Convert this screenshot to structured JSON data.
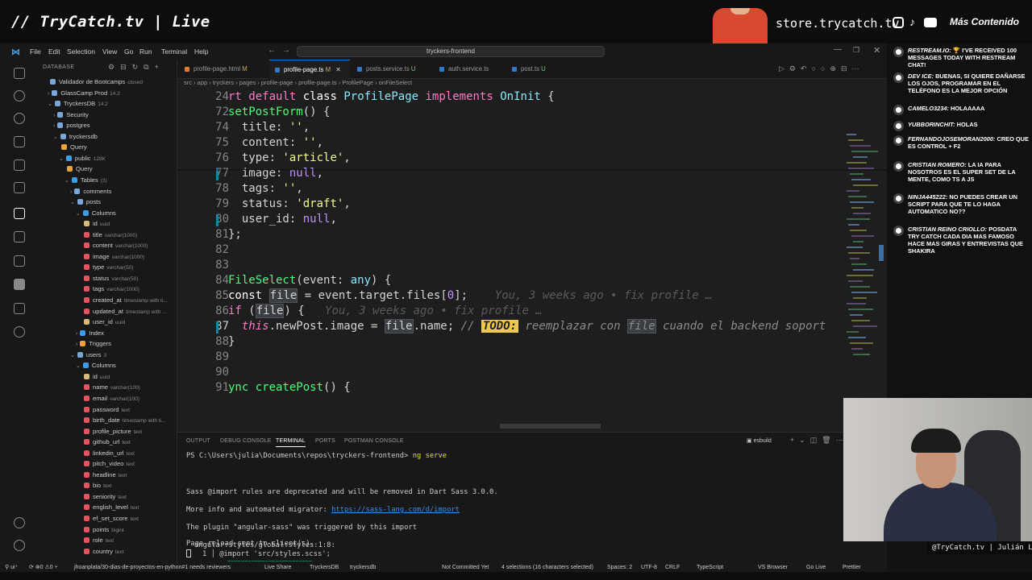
{
  "stream": {
    "title": "// TryCatch.tv | Live",
    "store": "store.trycatch.tv",
    "more_content": "Más Contenido",
    "caption": "@TryCatch.tv | Julián Luna"
  },
  "vscode": {
    "menu": [
      "File",
      "Edit",
      "Selection",
      "View",
      "Go",
      "Run",
      "Terminal",
      "Help"
    ],
    "command_center": "tryckers-frontend",
    "sidebar": {
      "title": "DATABASE",
      "tree": [
        {
          "label": "Validador de Bootcamps",
          "meta": "closed",
          "indent": 1,
          "chev": ""
        },
        {
          "label": "GlassCamp Prod",
          "meta": "14.2",
          "indent": 1,
          "chev": "›"
        },
        {
          "label": "TryckersDB",
          "meta": "14.2",
          "indent": 1,
          "chev": "⌄"
        },
        {
          "label": "Security",
          "meta": "",
          "indent": 2,
          "chev": "›"
        },
        {
          "label": "postgres",
          "meta": "",
          "indent": 2,
          "chev": "›"
        },
        {
          "label": "tryckersdb",
          "meta": "",
          "indent": 2,
          "chev": "⌄"
        },
        {
          "label": "Query",
          "meta": "",
          "indent": 3,
          "chev": ""
        },
        {
          "label": "public",
          "meta": "128K",
          "indent": 3,
          "chev": "⌄"
        },
        {
          "label": "Query",
          "meta": "",
          "indent": 4,
          "chev": ""
        },
        {
          "label": "Tables",
          "meta": "(3)",
          "indent": 4,
          "chev": "⌄"
        },
        {
          "label": "comments",
          "meta": "",
          "indent": 5,
          "chev": "›"
        },
        {
          "label": "posts",
          "meta": "",
          "indent": 5,
          "chev": "⌄"
        },
        {
          "label": "Columns",
          "meta": "",
          "indent": 6,
          "chev": "⌄"
        },
        {
          "label": "id",
          "meta": "uuid",
          "indent": 7,
          "chev": ""
        },
        {
          "label": "title",
          "meta": "varchar(1000)",
          "indent": 7,
          "chev": ""
        },
        {
          "label": "content",
          "meta": "varchar(1000)",
          "indent": 7,
          "chev": ""
        },
        {
          "label": "image",
          "meta": "varchar(1000)",
          "indent": 7,
          "chev": ""
        },
        {
          "label": "type",
          "meta": "varchar(50)",
          "indent": 7,
          "chev": ""
        },
        {
          "label": "status",
          "meta": "varchar(50)",
          "indent": 7,
          "chev": ""
        },
        {
          "label": "tags",
          "meta": "varchar(1000)",
          "indent": 7,
          "chev": ""
        },
        {
          "label": "created_at",
          "meta": "timestamp with ti...",
          "indent": 7,
          "chev": ""
        },
        {
          "label": "updated_at",
          "meta": "timestamp with ...",
          "indent": 7,
          "chev": ""
        },
        {
          "label": "user_id",
          "meta": "uuid",
          "indent": 7,
          "chev": ""
        },
        {
          "label": "Index",
          "meta": "",
          "indent": 6,
          "chev": "›"
        },
        {
          "label": "Triggers",
          "meta": "",
          "indent": 6,
          "chev": "›"
        },
        {
          "label": "users",
          "meta": "3",
          "indent": 5,
          "chev": "⌄"
        },
        {
          "label": "Columns",
          "meta": "",
          "indent": 6,
          "chev": "⌄"
        },
        {
          "label": "id",
          "meta": "uuid",
          "indent": 7,
          "chev": ""
        },
        {
          "label": "name",
          "meta": "varchar(100)",
          "indent": 7,
          "chev": ""
        },
        {
          "label": "email",
          "meta": "varchar(100)",
          "indent": 7,
          "chev": ""
        },
        {
          "label": "password",
          "meta": "text",
          "indent": 7,
          "chev": ""
        },
        {
          "label": "birth_date",
          "meta": "timestamp with ti...",
          "indent": 7,
          "chev": ""
        },
        {
          "label": "profile_picture",
          "meta": "text",
          "indent": 7,
          "chev": ""
        },
        {
          "label": "github_url",
          "meta": "text",
          "indent": 7,
          "chev": ""
        },
        {
          "label": "linkedin_url",
          "meta": "text",
          "indent": 7,
          "chev": ""
        },
        {
          "label": "pitch_video",
          "meta": "text",
          "indent": 7,
          "chev": ""
        },
        {
          "label": "headline",
          "meta": "text",
          "indent": 7,
          "chev": ""
        },
        {
          "label": "bio",
          "meta": "text",
          "indent": 7,
          "chev": ""
        },
        {
          "label": "seniority",
          "meta": "text",
          "indent": 7,
          "chev": ""
        },
        {
          "label": "english_level",
          "meta": "text",
          "indent": 7,
          "chev": ""
        },
        {
          "label": "ef_set_score",
          "meta": "text",
          "indent": 7,
          "chev": ""
        },
        {
          "label": "points",
          "meta": "bigint",
          "indent": 7,
          "chev": ""
        },
        {
          "label": "role",
          "meta": "text",
          "indent": 7,
          "chev": ""
        },
        {
          "label": "country",
          "meta": "text",
          "indent": 7,
          "chev": ""
        }
      ]
    },
    "tabs": [
      {
        "label": "profile-page.html",
        "status": "M",
        "color": "#e37933"
      },
      {
        "label": "profile-page.ts",
        "status": "M",
        "color": "#3178c6"
      },
      {
        "label": "posts.service.ts",
        "status": "U",
        "color": "#3178c6"
      },
      {
        "label": "auth.service.ts",
        "status": "",
        "color": "#3178c6"
      },
      {
        "label": "post.ts",
        "status": "U",
        "color": "#3178c6"
      }
    ],
    "breadcrumb": "src › app › tryckers › pages › profile-page › profile-page.ts › ProfilePage › onFileSelect",
    "code": [
      {
        "n": "24",
        "html": "<span class='kw'>rt</span> <span class='kw'>default</span> <span class='pr'>class</span> <span class='ty'>ProfilePage</span> <span class='kw'>implements</span> <span class='ty'>OnInit</span> {",
        "sticky": true
      },
      {
        "n": "72",
        "html": "<span class='fn'>setPostForm</span>() {",
        "sticky": true
      },
      {
        "n": "74",
        "html": "  title: <span class='st'>''</span>,"
      },
      {
        "n": "75",
        "html": "  content: <span class='st'>''</span>,"
      },
      {
        "n": "76",
        "html": "  type: <span class='st'>'article'</span>,"
      },
      {
        "n": "77",
        "html": "  image: <span class='nu'>null</span>,"
      },
      {
        "n": "78",
        "html": "  tags: <span class='st'>''</span>,"
      },
      {
        "n": "79",
        "html": "  status: <span class='st'>'draft'</span>,"
      },
      {
        "n": "80",
        "html": "  user_id: <span class='nu'>null</span>,"
      },
      {
        "n": "81",
        "html": "};"
      },
      {
        "n": "82",
        "html": ""
      },
      {
        "n": "83",
        "html": ""
      },
      {
        "n": "84",
        "html": "<span class='fn'>FileSelect</span>(event: <span class='ty'>any</span>) {"
      },
      {
        "n": "85",
        "html": "<span class='pr'>const</span> <span class='hl'>file</span> = event.target.files[<span class='nu'>0</span>];    <span class='blame'>You, 3 weeks ago • fix profile …</span>"
      },
      {
        "n": "86",
        "html": "<span class='kw'>if</span> (<span class='hl'>file</span>) {   <span class='blame'>You, 3 weeks ago • fix profile …</span>"
      },
      {
        "n": "87",
        "html": "  <span class='kw' style='font-style:italic'>this</span>.newPost.image = <span class='hl'>file</span>.name; <span class='cm'>// </span><span class='todo'>TODO:</span><span class='cm'> reemplazar con </span><span class='hl cm'>file</span><span class='cm'> cuando el backend soport</span>",
        "cur": true
      },
      {
        "n": "88",
        "html": "}"
      },
      {
        "n": "89",
        "html": ""
      },
      {
        "n": "90",
        "html": ""
      },
      {
        "n": "91",
        "html": "<span class='fn'>ync createPost</span>() {"
      }
    ],
    "panel_tabs": [
      "OUTPUT",
      "DEBUG CONSOLE",
      "TERMINAL",
      "PORTS",
      "POSTMAN CONSOLE"
    ],
    "panel_right": "esbuild",
    "terminal": {
      "prompt": "PS C:\\Users\\julia\\Documents\\repos\\tryckers-frontend>",
      "command": "ng serve",
      "line1": "Sass @import rules are deprecated and will be removed in Dart Sass 3.0.0.",
      "line2_pre": "More info and automated migrator: ",
      "line2_link": "https://sass-lang.com/d/import",
      "line3": "The plugin \"angular-sass\" was triggered by this import",
      "line4": "angular:styles/global:styles:1:8:",
      "line5_no": "1",
      "line5_code": "@import 'src/styles.scss';",
      "line5_squig": "~~~~~~~~~~~~~~~~~~~~~~~~~",
      "line6": "Page reload sent to client(s)."
    },
    "status": {
      "branch": "jhoanplata/30-dias-de-proyectos-en-python#1 needs reviewers",
      "liveshare": "Live Share",
      "db": "TryckersDB",
      "dbname": "tryckersdb",
      "commit": "Not Committed Yet",
      "selections": "4 selections (16 characters selected)",
      "spaces": "Spaces: 2",
      "encoding": "UTF-8",
      "eol": "CRLF",
      "lang": "TypeScript",
      "browser": "VS Browser",
      "golive": "Go Live",
      "prettier": "Prettier"
    }
  },
  "chat": [
    {
      "who": "RESTREAM.IO:",
      "text": "🏆 I'VE RECEIVED 100 MESSAGES TODAY WITH RESTREAM CHAT!"
    },
    {
      "who": "DEV ICE:",
      "text": "BUENAS, SI QUIERE DAÑARSE LOS OJOS, PROGRAMAR EN EL TELÉFONO ES LA MEJOR OPCIÓN"
    },
    {
      "who": "CAMELO3234:",
      "text": "HOLAAAAA"
    },
    {
      "who": "YUBBORINCHIT:",
      "text": "HOLAS"
    },
    {
      "who": "FERNANDOJOSEMORAN2000:",
      "text": "CREO QUE ES CONTROL + F2"
    },
    {
      "who": "CRISTIAN ROMERO:",
      "text": "LA IA PARA NOSOTROS ES EL SUPER SET DE LA MENTE, COMO TS A JS"
    },
    {
      "who": "NINJA445222:",
      "text": "NO PUEDES CREAR UN SCRIPT PARA QUE TE LO HAGA AUTOMATICO NO??"
    },
    {
      "who": "CRISTIAN REINO CRIOLLO:",
      "text": "POSDATA TRY CATCH CADA DIA MAS FAMOSO HACE MAS GIRAS Y ENTREVISTAS QUE SHAKIRA"
    }
  ]
}
